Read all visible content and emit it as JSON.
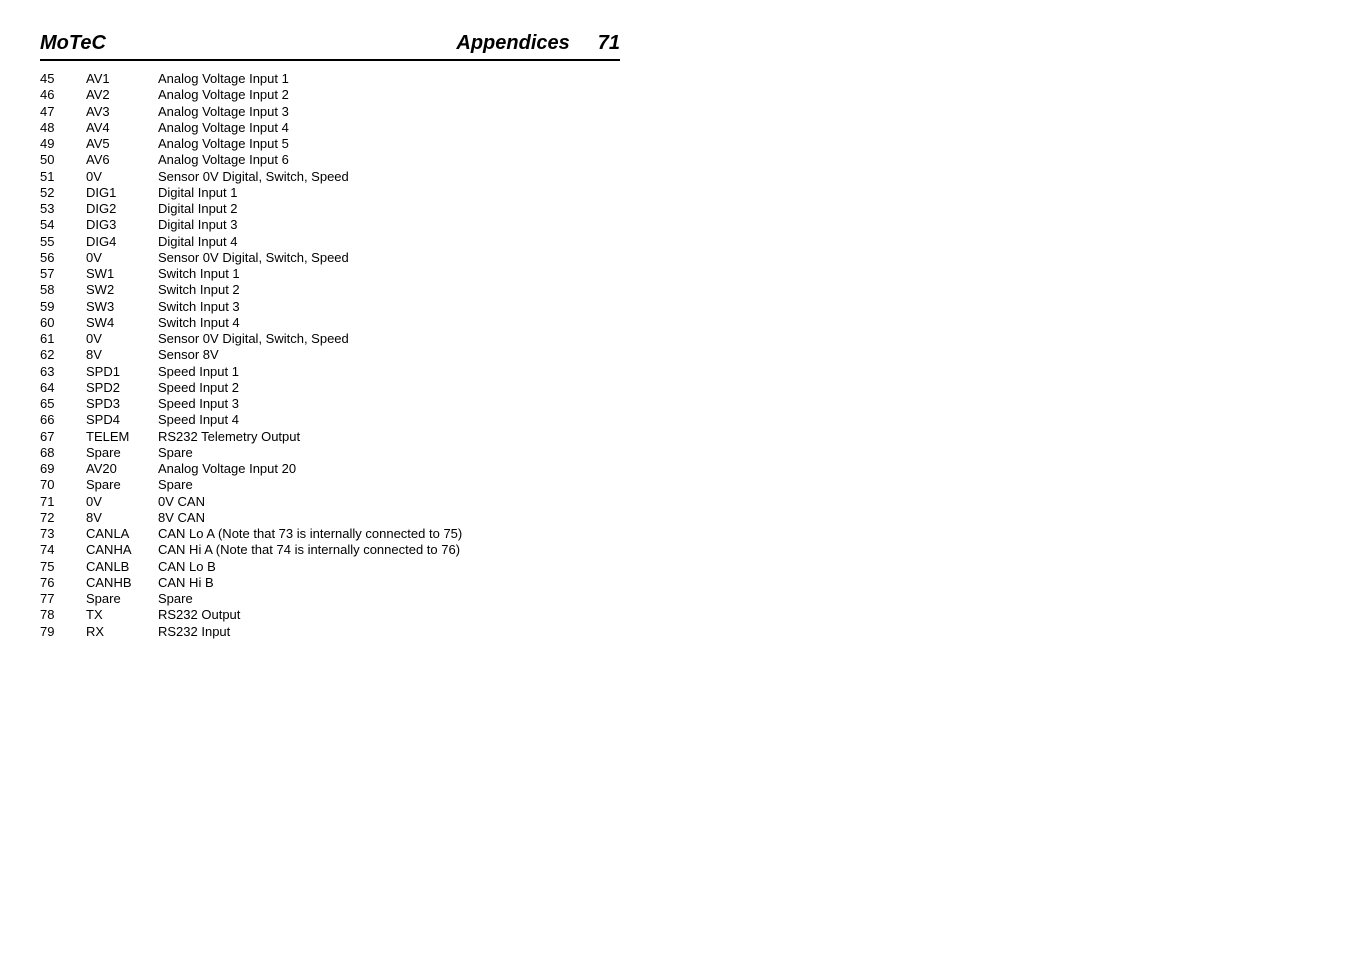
{
  "header": {
    "brand": "MoTeC",
    "section": "Appendices",
    "page_number": "71"
  },
  "pins": [
    {
      "pin": "45",
      "name": "AV1",
      "desc": "Analog Voltage Input 1"
    },
    {
      "pin": "46",
      "name": "AV2",
      "desc": "Analog Voltage Input 2"
    },
    {
      "pin": "47",
      "name": "AV3",
      "desc": "Analog Voltage Input 3"
    },
    {
      "pin": "48",
      "name": "AV4",
      "desc": "Analog Voltage Input 4"
    },
    {
      "pin": "49",
      "name": "AV5",
      "desc": "Analog Voltage Input 5"
    },
    {
      "pin": "50",
      "name": "AV6",
      "desc": "Analog Voltage Input 6"
    },
    {
      "pin": "51",
      "name": "0V",
      "desc": "Sensor 0V Digital, Switch, Speed"
    },
    {
      "pin": "52",
      "name": "DIG1",
      "desc": "Digital Input 1"
    },
    {
      "pin": "53",
      "name": "DIG2",
      "desc": "Digital Input 2"
    },
    {
      "pin": "54",
      "name": "DIG3",
      "desc": "Digital Input 3"
    },
    {
      "pin": "55",
      "name": "DIG4",
      "desc": "Digital Input 4"
    },
    {
      "pin": "56",
      "name": "0V",
      "desc": "Sensor 0V Digital, Switch, Speed"
    },
    {
      "pin": "57",
      "name": "SW1",
      "desc": "Switch Input 1"
    },
    {
      "pin": "58",
      "name": "SW2",
      "desc": "Switch Input 2"
    },
    {
      "pin": "59",
      "name": "SW3",
      "desc": "Switch Input 3"
    },
    {
      "pin": "60",
      "name": "SW4",
      "desc": "Switch Input 4"
    },
    {
      "pin": "61",
      "name": "0V",
      "desc": "Sensor 0V Digital, Switch, Speed"
    },
    {
      "pin": "62",
      "name": "8V",
      "desc": "Sensor 8V"
    },
    {
      "pin": "63",
      "name": "SPD1",
      "desc": "Speed Input 1"
    },
    {
      "pin": "64",
      "name": "SPD2",
      "desc": "Speed Input 2"
    },
    {
      "pin": "65",
      "name": "SPD3",
      "desc": "Speed Input 3"
    },
    {
      "pin": "66",
      "name": "SPD4",
      "desc": "Speed Input 4"
    },
    {
      "pin": "67",
      "name": "TELEM",
      "desc": "RS232 Telemetry Output"
    },
    {
      "pin": "68",
      "name": "Spare",
      "desc": "Spare"
    },
    {
      "pin": "69",
      "name": "AV20",
      "desc": "Analog Voltage Input 20"
    },
    {
      "pin": "70",
      "name": "Spare",
      "desc": "Spare"
    },
    {
      "pin": "71",
      "name": "0V",
      "desc": "0V CAN"
    },
    {
      "pin": "72",
      "name": "8V",
      "desc": "8V CAN"
    },
    {
      "pin": "73",
      "name": "CANLA",
      "desc": "CAN Lo A  (Note that 73 is internally connected to 75)"
    },
    {
      "pin": "74",
      "name": "CANHA",
      "desc": "CAN Hi A  (Note that 74 is internally connected to 76)"
    },
    {
      "pin": "75",
      "name": "CANLB",
      "desc": "CAN Lo B"
    },
    {
      "pin": "76",
      "name": "CANHB",
      "desc": "CAN Hi B"
    },
    {
      "pin": "77",
      "name": "Spare",
      "desc": "Spare"
    },
    {
      "pin": "78",
      "name": "TX",
      "desc": "RS232 Output"
    },
    {
      "pin": "79",
      "name": "RX",
      "desc": "RS232 Input"
    }
  ]
}
